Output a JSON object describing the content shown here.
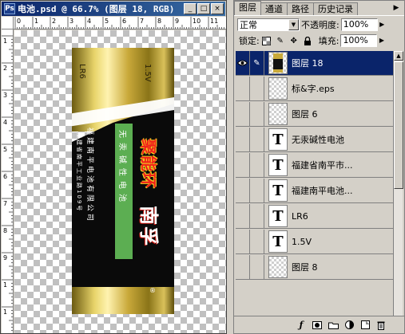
{
  "document": {
    "title": "电池.psd @ 66.7% (图层 18, RGB)",
    "window_buttons": [
      "_",
      "□",
      "×"
    ],
    "ruler_top_labels": [
      "0",
      "1",
      "2",
      "3",
      "4",
      "5",
      "6",
      "7",
      "8",
      "9",
      "10",
      "11"
    ],
    "ruler_left_labels": [
      "1",
      "2",
      "3",
      "4",
      "5",
      "6",
      "7",
      "8",
      "9",
      "1",
      "1"
    ]
  },
  "battery": {
    "label_lr6": "LR6",
    "label_voltage": "1.5V",
    "green_band_text": "无汞碱性电池",
    "brand_red": "聚能环",
    "brand_white": "南孚",
    "company_line1": "福建南平电池有限公司",
    "company_line2": "福建省南平工业路109号",
    "registered_mark": "®",
    "colors": {
      "gold": "#c9a93a",
      "black": "#0a0a0a",
      "green": "#5cae52",
      "red": "#e02a1a",
      "yellow": "#f5d020"
    }
  },
  "layers_panel": {
    "tabs": [
      "图层",
      "通道",
      "路径",
      "历史记录"
    ],
    "blend_mode": "正常",
    "opacity_label": "不透明度:",
    "opacity_value": "100%",
    "lock_label": "锁定:",
    "fill_label": "填充:",
    "fill_value": "100%",
    "layers": [
      {
        "name": "图层 18",
        "selected": true,
        "visible": true,
        "thumb": "battery",
        "linked_icon": "brush-icon"
      },
      {
        "name": "标&字.eps",
        "selected": false,
        "visible": false,
        "thumb": "checker",
        "linked_icon": ""
      },
      {
        "name": "图层 6",
        "selected": false,
        "visible": false,
        "thumb": "checker",
        "linked_icon": ""
      },
      {
        "name": "无汞碱性电池",
        "selected": false,
        "visible": false,
        "thumb": "T",
        "linked_icon": ""
      },
      {
        "name": "福建省南平市...",
        "selected": false,
        "visible": false,
        "thumb": "T",
        "linked_icon": ""
      },
      {
        "name": "福建南平电池...",
        "selected": false,
        "visible": false,
        "thumb": "T",
        "linked_icon": ""
      },
      {
        "name": "LR6",
        "selected": false,
        "visible": false,
        "thumb": "T",
        "linked_icon": ""
      },
      {
        "name": "1.5V",
        "selected": false,
        "visible": false,
        "thumb": "T",
        "linked_icon": ""
      },
      {
        "name": "图层 8",
        "selected": false,
        "visible": false,
        "thumb": "checker",
        "linked_icon": ""
      }
    ],
    "bottom_icons": [
      "layer-style-icon",
      "mask-icon",
      "new-set-icon",
      "adjustment-layer-icon",
      "new-layer-icon",
      "trash-icon"
    ]
  }
}
